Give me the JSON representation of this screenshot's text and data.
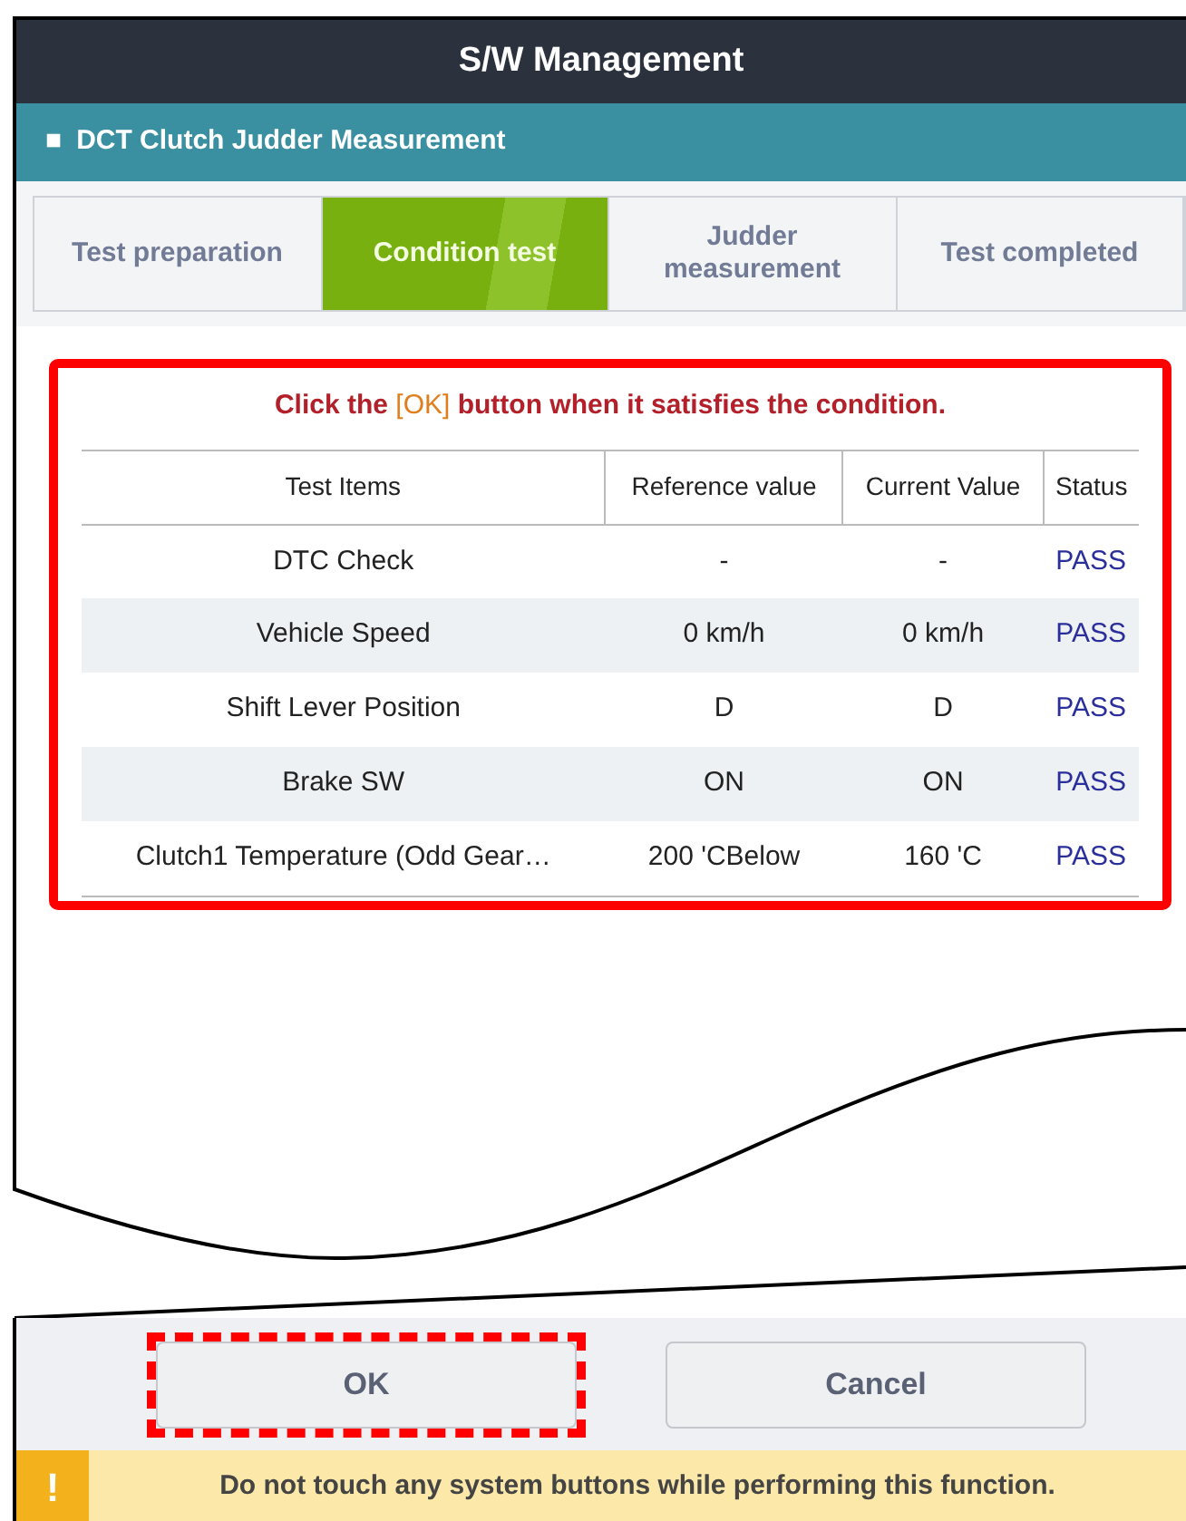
{
  "window": {
    "title": "S/W Management"
  },
  "section": {
    "marker": "■",
    "title": "DCT Clutch Judder Measurement"
  },
  "steps": [
    {
      "label": "Test preparation",
      "selected": false
    },
    {
      "label": "Condition test",
      "selected": true
    },
    {
      "label": "Judder measurement",
      "selected": false
    },
    {
      "label": "Test completed",
      "selected": false
    }
  ],
  "panel": {
    "highlighted": true,
    "message": [
      {
        "text": "Click the ",
        "kind": "plain"
      },
      {
        "text": "[OK]",
        "kind": "emphasis"
      },
      {
        "text": " button when it satisfies the condition.",
        "kind": "plain"
      }
    ],
    "table": {
      "columns": [
        "Test Items",
        "Reference value",
        "Current Value",
        "Status"
      ],
      "rows": [
        [
          "DTC Check",
          "-",
          "-",
          "PASS"
        ],
        [
          "Vehicle Speed",
          "0 km/h",
          "0 km/h",
          "PASS"
        ],
        [
          "Shift Lever Position",
          "D",
          "D",
          "PASS"
        ],
        [
          "Brake SW",
          "ON",
          "ON",
          "PASS"
        ],
        [
          "Clutch1 Temperature (Odd Gear…",
          "200 'CBelow",
          "160 'C",
          "PASS"
        ]
      ]
    }
  },
  "buttons": [
    {
      "label": "OK",
      "highlighted": true
    },
    {
      "label": "Cancel",
      "highlighted": false
    }
  ],
  "warning": {
    "icon": "!",
    "text": "Do not touch any system buttons while performing this function."
  }
}
